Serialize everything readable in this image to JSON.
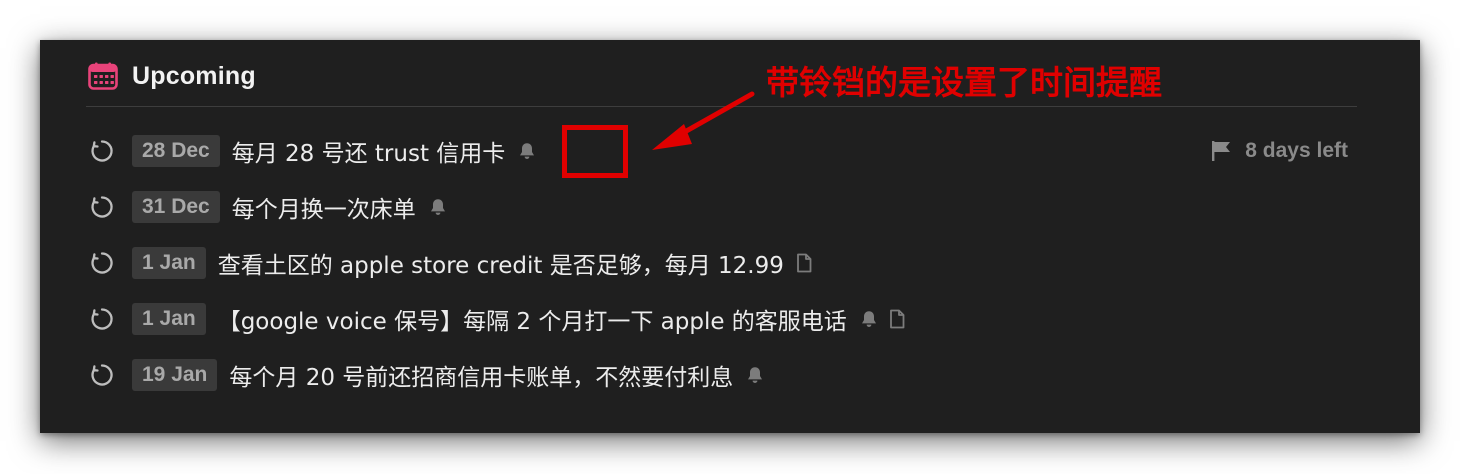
{
  "header": {
    "title": "Upcoming",
    "icon": "calendar-icon",
    "accent_color": "#e8437a"
  },
  "tasks": [
    {
      "date": "28 Dec",
      "title": "每月 28 号还 trust 信用卡",
      "icons": [
        "bell-icon"
      ],
      "deadline": "8 days left"
    },
    {
      "date": "31 Dec",
      "title": "每个月换一次床单",
      "icons": [
        "bell-icon"
      ]
    },
    {
      "date": "1 Jan",
      "title": "查看土区的 apple store credit 是否足够，每月 12.99",
      "icons": [
        "note-icon"
      ]
    },
    {
      "date": "1 Jan",
      "title": "【google voice 保号】每隔 2 个月打一下 apple 的客服电话",
      "icons": [
        "bell-icon",
        "note-icon"
      ]
    },
    {
      "date": "19 Jan",
      "title": "每个月 20 号前还招商信用卡账单，不然要付利息",
      "icons": [
        "bell-icon"
      ]
    }
  ],
  "annotation": {
    "text": "带铃铛的是设置了时间提醒",
    "color": "#e00000"
  },
  "colors": {
    "panel_bg": "#1f1f1f",
    "badge_bg": "#3a3a3a",
    "badge_text": "#a9a9a9",
    "text": "#ececec",
    "muted": "#8a8a8a"
  }
}
